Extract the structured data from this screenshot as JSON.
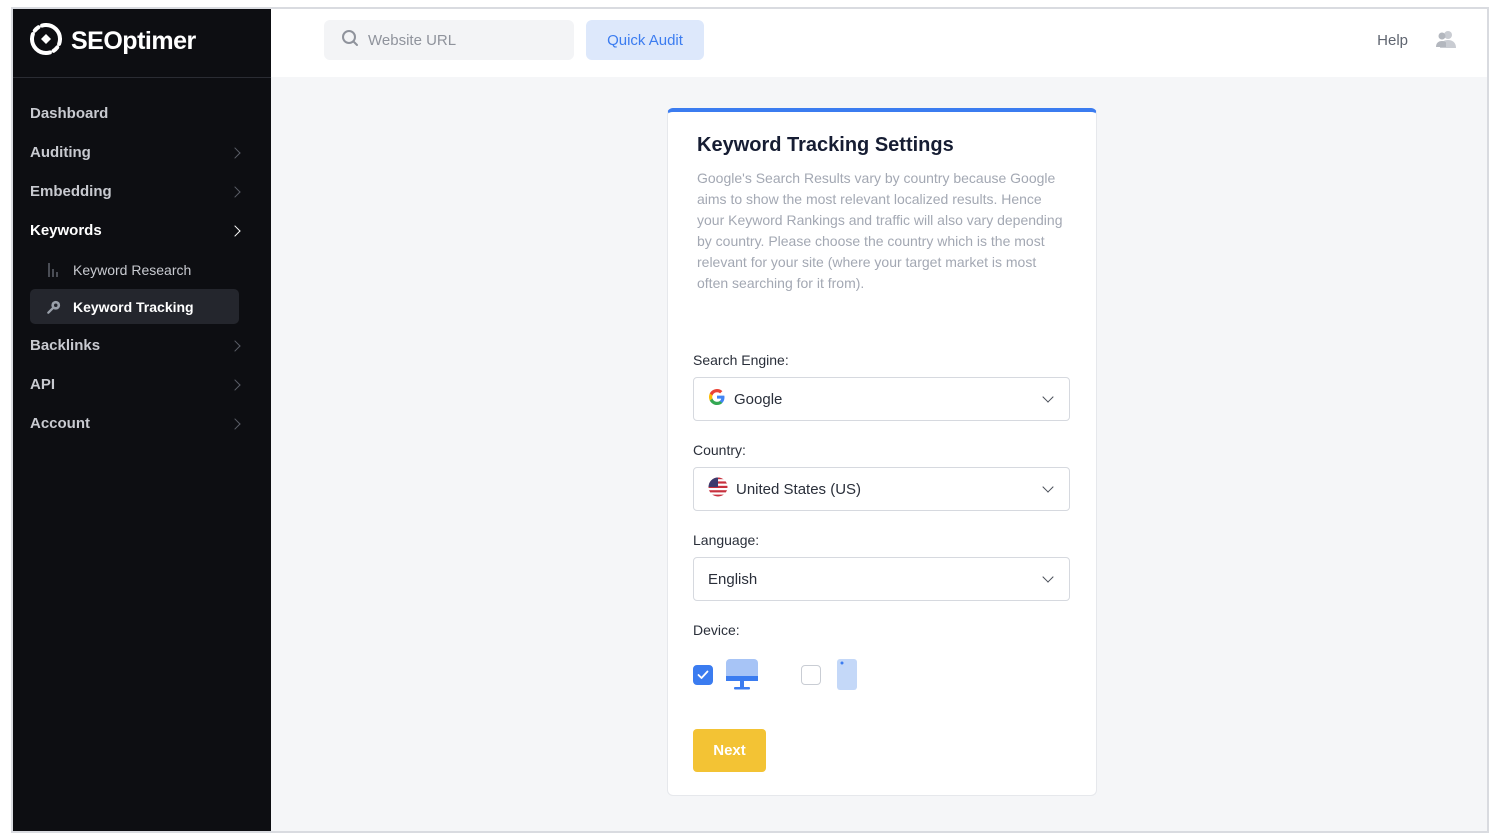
{
  "app": {
    "logo_text": "SEOptimer"
  },
  "sidebar": {
    "items": [
      {
        "label": "Dashboard"
      },
      {
        "label": "Auditing"
      },
      {
        "label": "Embedding"
      },
      {
        "label": "Keywords",
        "active": true,
        "children": [
          {
            "label": "Keyword Research",
            "icon": "bar-chart-icon"
          },
          {
            "label": "Keyword Tracking",
            "icon": "magnifier-icon",
            "active": true
          }
        ]
      },
      {
        "label": "Backlinks"
      },
      {
        "label": "API"
      },
      {
        "label": "Account"
      }
    ]
  },
  "header": {
    "search_placeholder": "Website URL",
    "quick_audit_label": "Quick Audit",
    "help_label": "Help"
  },
  "form": {
    "title": "Keyword Tracking Settings",
    "description": "Google's Search Results vary by country because Google aims to show the most relevant localized results. Hence your Keyword Rankings and traffic will also vary depending by country. Please choose the country which is the most relevant for your site (where your target market is most often searching for it from).",
    "search_engine": {
      "label": "Search Engine:",
      "value": "Google",
      "icon": "google-icon"
    },
    "country": {
      "label": "Country:",
      "value": "United States (US)",
      "icon": "us-flag-icon"
    },
    "language": {
      "label": "Language:",
      "value": "English"
    },
    "device": {
      "label": "Device:",
      "desktop_checked": true,
      "mobile_checked": false
    },
    "next_label": "Next"
  },
  "colors": {
    "sidebar_bg": "#0d0e12",
    "accent_blue": "#3b7cf0",
    "next_yellow": "#f3c334"
  }
}
